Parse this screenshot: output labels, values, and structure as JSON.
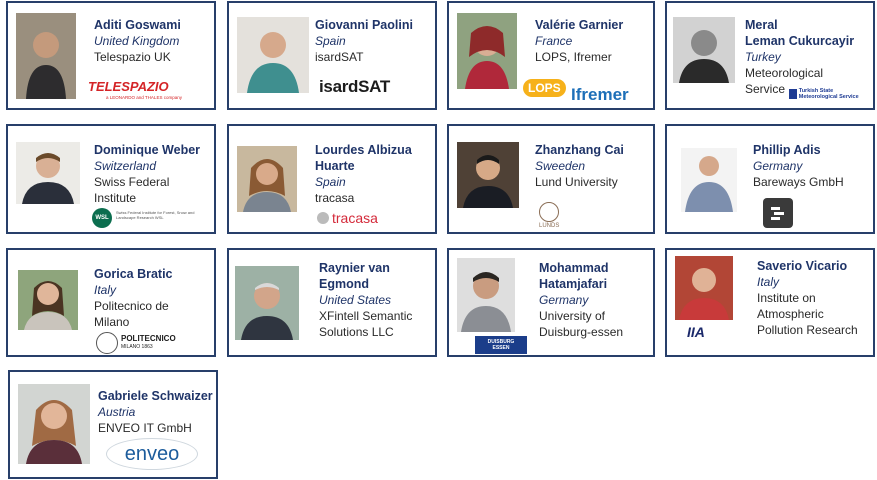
{
  "people": [
    {
      "name": "Aditi Goswami",
      "country": "United Kingdom",
      "org": "Telespazio UK",
      "logo": {
        "text": "TELESPAZIO",
        "sub": "a LEONARDO and THALES company",
        "color": "#d42427"
      }
    },
    {
      "name": "Giovanni Paolini",
      "country": "Spain",
      "org": "isardSAT",
      "logo": {
        "text": "isardSAT",
        "color": "#1c1c1c",
        "accent": "#d42427"
      }
    },
    {
      "name": "Valérie Garnier",
      "country": "France",
      "org": "LOPS, Ifremer",
      "logo": {
        "text": "LOPS",
        "text2": "Ifremer",
        "color": "#1d6fb8"
      }
    },
    {
      "name_lines": [
        "Meral",
        "Leman Cukurcayir"
      ],
      "country": "Turkey",
      "org_lines": [
        "Meteorological",
        "Service"
      ],
      "logo": {
        "text": "Turkish State Meteorological Service",
        "color": "#1f3c94"
      }
    },
    {
      "name": "Dominique Weber",
      "country": "Switzerland",
      "org_lines": [
        "Swiss Federal",
        "Institute"
      ],
      "logo": {
        "text": "WSL",
        "sub": "Swiss Federal Institute for Forest, Snow and Landscape Research WSL",
        "color": "#0c6e4f"
      }
    },
    {
      "name_lines": [
        "Lourdes Albizua",
        "Huarte"
      ],
      "country": "Spain",
      "org": "tracasa",
      "logo": {
        "text": "tracasa",
        "color": "#d42a3a"
      }
    },
    {
      "name": "Zhanzhang Cai",
      "country": "Sweeden",
      "org": "Lund University",
      "logo": {
        "text": "LUNDS",
        "color": "#8a6d55"
      }
    },
    {
      "name": "Phillip Adis",
      "country": "Germany",
      "org": "Bareways GmbH",
      "logo": {
        "text": "",
        "color": "#3a3a3a"
      }
    },
    {
      "name": "Gorica Bratic",
      "country": "Italy",
      "org_lines": [
        "Politecnico de",
        "Milano"
      ],
      "logo": {
        "text": "POLITECNICO",
        "sub": "MILANO 1863",
        "color": "#1c1c1c"
      }
    },
    {
      "name_lines": [
        "Raynier van",
        "Egmond"
      ],
      "country": "United  States",
      "org_lines": [
        "XFintell Semantic",
        "Solutions LLC"
      ]
    },
    {
      "name_lines": [
        "Mohammad",
        "Hatamjafari"
      ],
      "country": "Germany",
      "org_lines": [
        "University of",
        "Duisburg-essen"
      ],
      "logo": {
        "text": "DUISBURG",
        "text2": "ESSEN",
        "color": "#1b3d8a"
      }
    },
    {
      "name": "Saverio Vicario",
      "country": "Italy",
      "org_lines": [
        "Institute on",
        "Atmospheric",
        "Pollution Research"
      ],
      "logo": {
        "text": "IIA",
        "color": "#1c2a6b"
      }
    },
    {
      "name": "Gabriele Schwaizer",
      "country": "Austria",
      "org": "ENVEO IT GmbH",
      "logo": {
        "text": "enveo",
        "color": "#1c5c9c"
      }
    }
  ]
}
